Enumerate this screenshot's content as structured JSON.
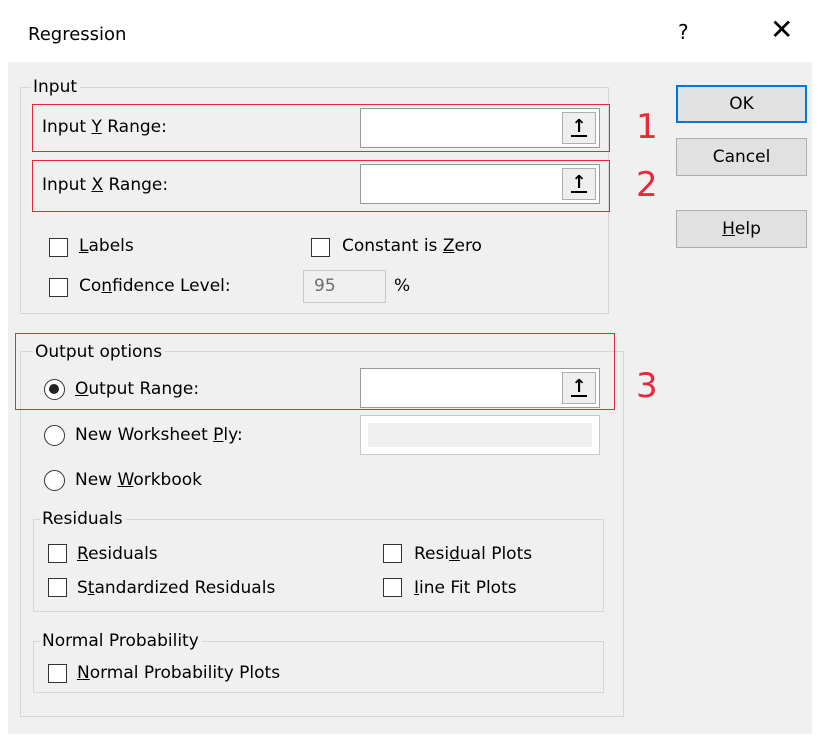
{
  "window": {
    "title": "Regression",
    "help_glyph": "?",
    "close_glyph": "✕"
  },
  "input_group": {
    "label": "Input",
    "y_range": {
      "pre": "Input ",
      "key": "Y",
      "post": " Range:",
      "value": "",
      "annotation": "1"
    },
    "x_range": {
      "pre": "Input ",
      "key": "X",
      "post": " Range:",
      "value": "",
      "annotation": "2"
    },
    "labels": {
      "key": "L",
      "post": "abels",
      "checked": false
    },
    "constant_is_zero": {
      "pre": "Constant is ",
      "key": "Z",
      "post": "ero",
      "checked": false
    },
    "confidence": {
      "pre": "Co",
      "key": "n",
      "post": "fidence Level:",
      "checked": false,
      "value": "95",
      "unit": "%"
    }
  },
  "output_group": {
    "label": "Output options",
    "annotation": "3",
    "output_range": {
      "key": "O",
      "post": "utput Range:",
      "selected": true,
      "value": ""
    },
    "new_worksheet": {
      "pre": "New Worksheet ",
      "key": "P",
      "post": "ly:",
      "selected": false,
      "value": ""
    },
    "new_workbook": {
      "pre": "New ",
      "key": "W",
      "post": "orkbook",
      "selected": false
    }
  },
  "residuals_group": {
    "label": "Residuals",
    "residuals": {
      "key": "R",
      "post": "esiduals",
      "checked": false
    },
    "standardized": {
      "pre": "S",
      "key": "t",
      "post": "andardized Residuals",
      "checked": false
    },
    "residual_plots": {
      "pre": "Resi",
      "key": "d",
      "post": "ual Plots",
      "checked": false
    },
    "line_fit": {
      "key": "I",
      "post": "ine Fit Plots",
      "checked": false
    }
  },
  "normal_group": {
    "label": "Normal Probability",
    "plots": {
      "key": "N",
      "post": "ormal Probability Plots",
      "checked": false
    }
  },
  "buttons": {
    "ok": "OK",
    "cancel": "Cancel",
    "help": {
      "key": "H",
      "post": "elp"
    }
  },
  "colors": {
    "annotation_red": "#e8293a",
    "default_button_blue": "#0078d7",
    "dialog_bg": "#f0f0f0"
  },
  "icons": {
    "ref_button": "collapse-arrow-up-icon"
  }
}
